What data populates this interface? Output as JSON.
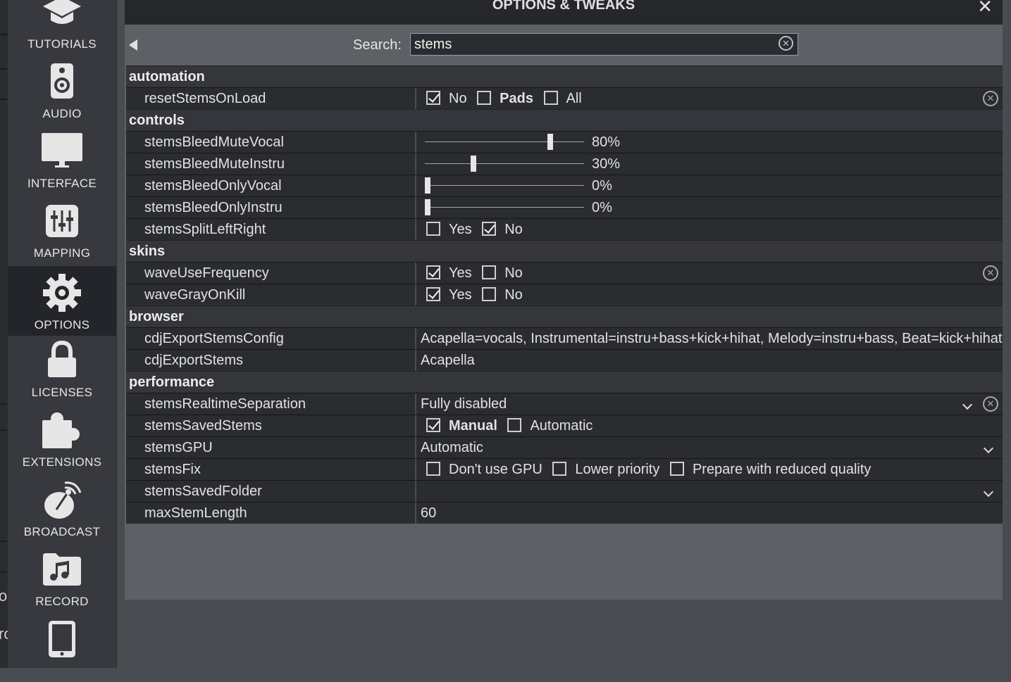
{
  "panel": {
    "title": "OPTIONS & TWEAKS"
  },
  "search": {
    "label": "Search:",
    "value": "stems"
  },
  "left_fragments": [
    "ou",
    "ro"
  ],
  "sidebar": {
    "items": [
      {
        "label": "TUTORIALS",
        "icon": "graduation-cap-icon",
        "active": false
      },
      {
        "label": "AUDIO",
        "icon": "speaker-icon",
        "active": false
      },
      {
        "label": "INTERFACE",
        "icon": "monitor-icon",
        "active": false
      },
      {
        "label": "MAPPING",
        "icon": "sliders-icon",
        "active": false
      },
      {
        "label": "OPTIONS",
        "icon": "gear-icon",
        "active": true
      },
      {
        "label": "LICENSES",
        "icon": "lock-icon",
        "active": false
      },
      {
        "label": "EXTENSIONS",
        "icon": "puzzle-icon",
        "active": false
      },
      {
        "label": "BROADCAST",
        "icon": "satellite-dish-icon",
        "active": false
      },
      {
        "label": "RECORD",
        "icon": "music-folder-icon",
        "active": false
      },
      {
        "label": "",
        "icon": "tablet-icon",
        "active": false
      }
    ]
  },
  "categories": {
    "automation": "automation",
    "controls": "controls",
    "skins": "skins",
    "browser": "browser",
    "performance": "performance"
  },
  "settings": {
    "resetStemsOnLoad": {
      "name": "resetStemsOnLoad",
      "options": [
        {
          "label": "No",
          "checked": true
        },
        {
          "label": "Pads",
          "checked": false,
          "bold": true
        },
        {
          "label": "All",
          "checked": false
        }
      ]
    },
    "stemsBleedMuteVocal": {
      "name": "stemsBleedMuteVocal",
      "value": 80,
      "display": "80%"
    },
    "stemsBleedMuteInstru": {
      "name": "stemsBleedMuteInstru",
      "value": 30,
      "display": "30%"
    },
    "stemsBleedOnlyVocal": {
      "name": "stemsBleedOnlyVocal",
      "value": 0,
      "display": "0%"
    },
    "stemsBleedOnlyInstru": {
      "name": "stemsBleedOnlyInstru",
      "value": 0,
      "display": "0%"
    },
    "stemsSplitLeftRight": {
      "name": "stemsSplitLeftRight",
      "options": [
        {
          "label": "Yes",
          "checked": false
        },
        {
          "label": "No",
          "checked": true
        }
      ]
    },
    "waveUseFrequency": {
      "name": "waveUseFrequency",
      "options": [
        {
          "label": "Yes",
          "checked": true
        },
        {
          "label": "No",
          "checked": false
        }
      ]
    },
    "waveGrayOnKill": {
      "name": "waveGrayOnKill",
      "options": [
        {
          "label": "Yes",
          "checked": true
        },
        {
          "label": "No",
          "checked": false
        }
      ]
    },
    "cdjExportStemsConfig": {
      "name": "cdjExportStemsConfig",
      "value": "Acapella=vocals, Instrumental=instru+bass+kick+hihat, Melody=instru+bass, Beat=kick+hihat"
    },
    "cdjExportStems": {
      "name": "cdjExportStems",
      "value": "Acapella"
    },
    "stemsRealtimeSeparation": {
      "name": "stemsRealtimeSeparation",
      "value": "Fully disabled"
    },
    "stemsSavedStems": {
      "name": "stemsSavedStems",
      "options": [
        {
          "label": "Manual",
          "checked": true,
          "bold": true
        },
        {
          "label": "Automatic",
          "checked": false
        }
      ]
    },
    "stemsGPU": {
      "name": "stemsGPU",
      "value": "Automatic"
    },
    "stemsFix": {
      "name": "stemsFix",
      "options": [
        {
          "label": "Don't use GPU",
          "checked": false
        },
        {
          "label": "Lower priority",
          "checked": false
        },
        {
          "label": "Prepare with reduced quality",
          "checked": false
        }
      ]
    },
    "stemsSavedFolder": {
      "name": "stemsSavedFolder",
      "value": ""
    },
    "maxStemLength": {
      "name": "maxStemLength",
      "value": "60"
    }
  }
}
